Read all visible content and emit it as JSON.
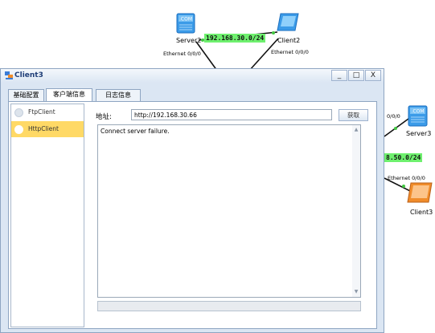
{
  "topology": {
    "server2": {
      "label": "Server2",
      "icon_text": ".COM"
    },
    "client2": {
      "label": "Client2"
    },
    "server3": {
      "label": "Server3",
      "icon_text": ".COM"
    },
    "client3": {
      "label": "Client3"
    },
    "net_top": "192.168.30.0/24",
    "net_right": "8.50.0/24",
    "ports": {
      "server2_eth": "Ethernet 0/0/0",
      "client2_eth": "Ethernet 0/0/0",
      "server3_eth": "0/0/0",
      "client3_eth": "Ethernet 0/0/0"
    },
    "colors": {
      "link_green": "#6ef06e",
      "server_blue": "#3b9be8",
      "client_orange": "#f08c2a"
    }
  },
  "window": {
    "title": "Client3",
    "icon": "client-app-icon",
    "buttons": {
      "minimize": "_",
      "maximize": "□",
      "close": "X"
    },
    "tabs": [
      {
        "label": "基础配置",
        "active": false
      },
      {
        "label": "客户端信息",
        "active": true
      },
      {
        "label": "日志信息",
        "active": false
      }
    ],
    "sidebar": [
      {
        "label": "FtpClient",
        "selected": false
      },
      {
        "label": "HttpClient",
        "selected": true
      }
    ],
    "address_label": "地址:",
    "address_value": "http://192.168.30.66",
    "fetch_button": "获取",
    "output_text": "Connect server failure.",
    "colors": {
      "selected": "#ffd966",
      "titlebar_text": "#1f3e78"
    }
  }
}
